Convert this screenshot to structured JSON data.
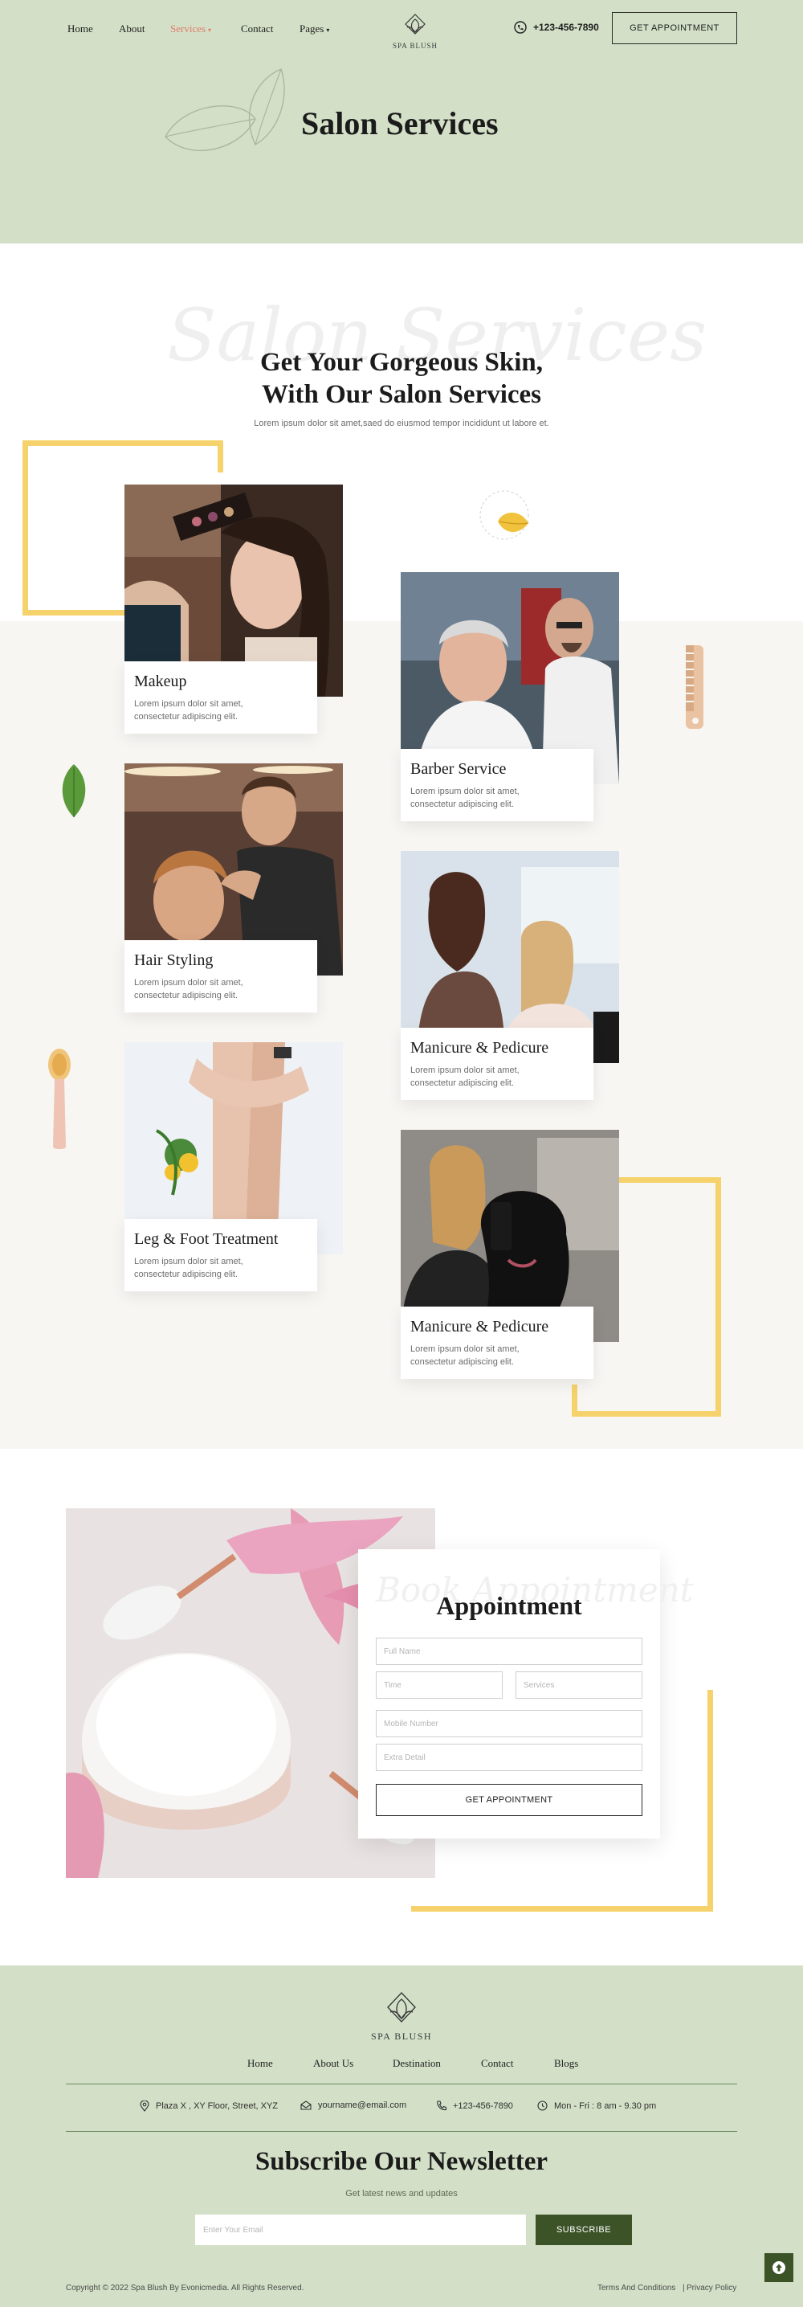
{
  "nav": {
    "items": [
      {
        "label": "Home"
      },
      {
        "label": "About"
      },
      {
        "label": "Services"
      },
      {
        "label": "Contact"
      },
      {
        "label": "Pages"
      }
    ],
    "logo_text": "SPA BLUSH",
    "phone": "+123-456-7890",
    "cta_label": "GET APPOINTMENT"
  },
  "hero": {
    "title": "Salon Services"
  },
  "services": {
    "watermark": "Salon Services",
    "title_line1": "Get Your Gorgeous Skin,",
    "title_line2": "With Our Salon Services",
    "subtitle": "Lorem ipsum dolor sit amet,saed do eiusmod tempor incididunt ut labore et.",
    "cards": [
      {
        "title": "Makeup",
        "desc": "Lorem ipsum dolor sit amet, consectetur adipiscing elit."
      },
      {
        "title": "Barber Service",
        "desc": "Lorem ipsum dolor sit amet, consectetur adipiscing elit."
      },
      {
        "title": "Hair Styling",
        "desc": "Lorem ipsum dolor sit amet, consectetur adipiscing elit."
      },
      {
        "title": "Manicure & Pedicure",
        "desc": "Lorem ipsum dolor sit amet, consectetur adipiscing elit."
      },
      {
        "title": "Leg & Foot Treatment",
        "desc": "Lorem ipsum dolor sit amet, consectetur adipiscing elit."
      },
      {
        "title": "Manicure & Pedicure",
        "desc": "Lorem ipsum dolor sit amet, consectetur adipiscing elit."
      }
    ]
  },
  "appointment": {
    "watermark": "Book Appointment",
    "title": "Appointment",
    "placeholders": {
      "full_name": "Full Name",
      "time": "Time",
      "services": "Services",
      "mobile": "Mobile Number",
      "extra": "Extra Detail"
    },
    "submit_label": "GET APPOINTMENT"
  },
  "footer": {
    "logo_text": "SPA BLUSH",
    "nav": [
      {
        "label": "Home"
      },
      {
        "label": "About Us"
      },
      {
        "label": "Destination"
      },
      {
        "label": "Contact"
      },
      {
        "label": "Blogs"
      }
    ],
    "info": {
      "address": "Plaza X , XY Floor, Street, XYZ",
      "email": "yourname@email.com",
      "phone": "+123-456-7890",
      "hours": "Mon - Fri : 8 am - 9.30 pm"
    },
    "newsletter": {
      "title": "Subscribe Our Newsletter",
      "subtitle": "Get latest news and updates",
      "placeholder": "Enter Your Email",
      "button_label": "SUBSCRIBE"
    },
    "copyright": "Copyright © 2022 Spa Blush By Evonicmedia. All Rights Reserved.",
    "terms": "Terms And Conditions",
    "separator": "|",
    "privacy": "Privacy Policy"
  },
  "colors": {
    "sage": "#d3e0c7",
    "accent_yellow": "#f5d26b",
    "dark_green": "#3c5328",
    "active_nav": "#e07b6a"
  },
  "icons": [
    "lotus-logo-icon",
    "phone-icon",
    "leaf-outline-icon",
    "leaf-icon",
    "comb-icon",
    "brush-icon",
    "location-icon",
    "mail-icon",
    "clock-icon",
    "arrow-up-icon"
  ]
}
